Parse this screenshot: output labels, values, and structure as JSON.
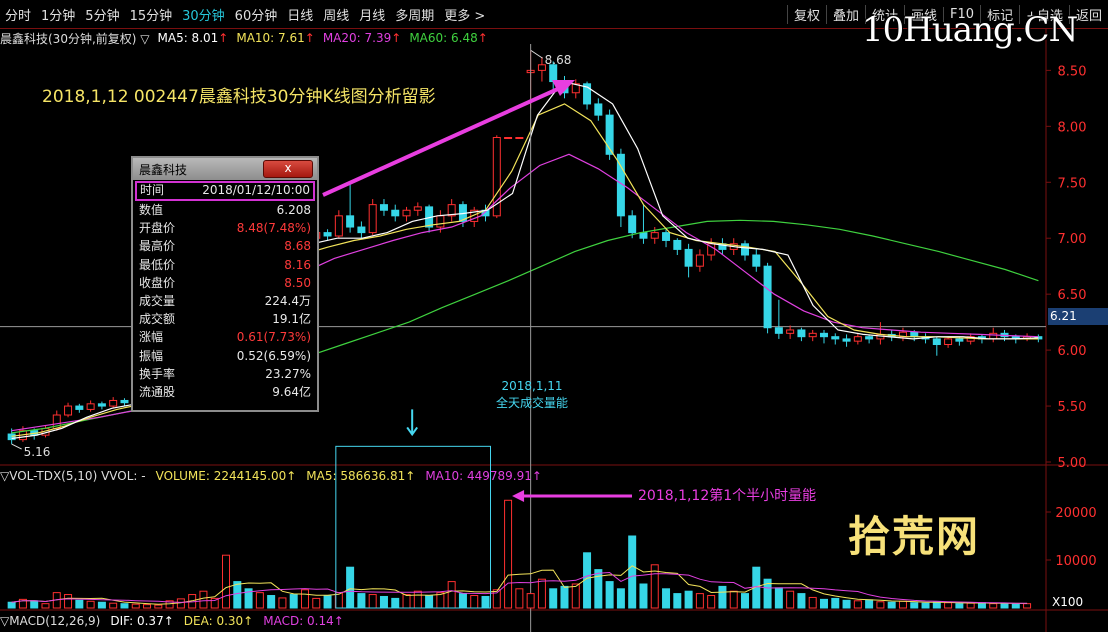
{
  "toolbar": {
    "periods": [
      "分时",
      "1分钟",
      "5分钟",
      "15分钟",
      "30分钟",
      "60分钟",
      "日线",
      "周线",
      "月线",
      "多周期",
      "更多 >"
    ],
    "active_period": "30分钟",
    "right_buttons": [
      "复权",
      "叠加",
      "统计",
      "画线",
      "F10",
      "标记",
      "+自选",
      "返回"
    ]
  },
  "brand_logo": "10Huang.CN",
  "brand_watermark": "拾荒网",
  "ma_legend": {
    "title": "晨鑫科技(30分钟,前复权) ▽",
    "ma5": "MA5: 8.01",
    "ma10": "MA10: 7.61",
    "ma20": "MA20: 7.39",
    "ma60": "MA60: 6.48",
    "arrow": "↑"
  },
  "annotation": "2018,1,12 002447晨鑫科技30分钟K线图分析留影",
  "volume_note": {
    "line1": "2018,1,11",
    "line2": "全天成交量能"
  },
  "volume_bar_label": "2018,1,12第1个半小时量能",
  "vol_legend": {
    "title": "▽VOL-TDX(5,10)  VVOL: -",
    "volume": "VOLUME: 2244145.00↑",
    "ma5": "MA5: 586636.81↑",
    "ma10": "MA10: 449789.91↑"
  },
  "macd_legend": {
    "title": "▽MACD(12,26,9)",
    "dif": "DIF: 0.37↑",
    "dea": "DEA: 0.30↑",
    "macd": "MACD: 0.14↑"
  },
  "price_axis": [
    "8.50",
    "8.00",
    "7.50",
    "7.00",
    "6.50",
    "6.00",
    "5.50",
    "5.00"
  ],
  "volume_axis": [
    "20000",
    "10000"
  ],
  "volume_unit": "X100",
  "current_price_tag": "6.21",
  "high_label": "8.68",
  "low_label": "5.16",
  "info_window": {
    "title": "晨鑫科技",
    "close_label": "x",
    "rows": [
      {
        "k": "时间",
        "v": "2018/01/12/10:00",
        "red": false,
        "hl": true
      },
      {
        "k": "数值",
        "v": "6.208",
        "red": false
      },
      {
        "k": "开盘价",
        "v": "8.48(7.48%)",
        "red": true
      },
      {
        "k": "最高价",
        "v": "8.68",
        "red": true
      },
      {
        "k": "最低价",
        "v": "8.16",
        "red": true
      },
      {
        "k": "收盘价",
        "v": "8.50",
        "red": true
      },
      {
        "k": "成交量",
        "v": "224.4万",
        "red": false
      },
      {
        "k": "成交额",
        "v": "19.1亿",
        "red": false
      },
      {
        "k": "涨幅",
        "v": "0.61(7.73%)",
        "red": true
      },
      {
        "k": "振幅",
        "v": "0.52(6.59%)",
        "red": false
      },
      {
        "k": "换手率",
        "v": "23.27%",
        "red": false
      },
      {
        "k": "流通股",
        "v": "9.64亿",
        "red": false
      }
    ]
  },
  "colors": {
    "up": "#ff3030",
    "down": "#36d6e7",
    "ma5": "#ffffff",
    "ma10": "#f2e35a",
    "ma20": "#e040e0",
    "ma60": "#3fd13f",
    "grid": "#7a0f0f"
  },
  "chart_data": {
    "type": "candlestick",
    "price_range": [
      5.0,
      8.7
    ],
    "volume_range": [
      0,
      25000
    ],
    "candles": [
      [
        5.25,
        5.2,
        5.3,
        5.16
      ],
      [
        5.2,
        5.28,
        5.32,
        5.18
      ],
      [
        5.28,
        5.24,
        5.3,
        5.2
      ],
      [
        5.24,
        5.3,
        5.33,
        5.22
      ],
      [
        5.3,
        5.42,
        5.46,
        5.28
      ],
      [
        5.42,
        5.5,
        5.53,
        5.4
      ],
      [
        5.5,
        5.47,
        5.52,
        5.44
      ],
      [
        5.47,
        5.52,
        5.55,
        5.45
      ],
      [
        5.52,
        5.5,
        5.54,
        5.47
      ],
      [
        5.5,
        5.55,
        5.58,
        5.48
      ],
      [
        5.55,
        5.53,
        5.57,
        5.5
      ],
      [
        5.53,
        5.56,
        5.6,
        5.51
      ],
      [
        5.56,
        5.6,
        5.63,
        5.54
      ],
      [
        5.6,
        5.65,
        5.68,
        5.58
      ],
      [
        5.65,
        5.7,
        5.72,
        5.62
      ],
      [
        6.5,
        6.6,
        6.72,
        6.45
      ],
      [
        6.6,
        6.72,
        6.75,
        6.58
      ],
      [
        6.72,
        6.75,
        6.78,
        6.7
      ],
      [
        6.75,
        6.75,
        6.75,
        6.75
      ],
      [
        6.9,
        7.25,
        7.3,
        6.85
      ],
      [
        7.25,
        7.1,
        7.28,
        7.05
      ],
      [
        7.1,
        6.95,
        7.12,
        6.9
      ],
      [
        6.95,
        7.0,
        7.05,
        6.88
      ],
      [
        7.0,
        6.95,
        7.03,
        6.9
      ],
      [
        6.95,
        6.98,
        7.02,
        6.92
      ],
      [
        6.98,
        6.9,
        7.0,
        6.85
      ],
      [
        6.9,
        7.0,
        7.05,
        6.86
      ],
      [
        7.0,
        7.05,
        7.1,
        6.95
      ],
      [
        7.05,
        7.02,
        7.08,
        6.98
      ],
      [
        7.02,
        7.2,
        7.25,
        7.0
      ],
      [
        7.2,
        7.1,
        7.48,
        7.05
      ],
      [
        7.1,
        7.05,
        7.15,
        7.0
      ],
      [
        7.05,
        7.3,
        7.35,
        7.03
      ],
      [
        7.3,
        7.25,
        7.35,
        7.2
      ],
      [
        7.25,
        7.2,
        7.3,
        7.15
      ],
      [
        7.2,
        7.25,
        7.28,
        7.15
      ],
      [
        7.25,
        7.28,
        7.32,
        7.2
      ],
      [
        7.28,
        7.1,
        7.3,
        7.05
      ],
      [
        7.1,
        7.2,
        7.25,
        7.05
      ],
      [
        7.2,
        7.3,
        7.35,
        7.15
      ],
      [
        7.3,
        7.15,
        7.33,
        7.1
      ],
      [
        7.15,
        7.25,
        7.28,
        7.1
      ],
      [
        7.25,
        7.2,
        7.3,
        7.15
      ],
      [
        7.2,
        7.9,
        7.92,
        7.18
      ],
      [
        7.9,
        7.9,
        7.9,
        7.9
      ],
      [
        7.9,
        7.9,
        7.9,
        7.9
      ],
      [
        8.48,
        8.5,
        8.68,
        8.16
      ],
      [
        8.5,
        8.55,
        8.62,
        8.4
      ],
      [
        8.55,
        8.4,
        8.58,
        8.3
      ],
      [
        8.4,
        8.3,
        8.45,
        8.25
      ],
      [
        8.3,
        8.38,
        8.42,
        8.25
      ],
      [
        8.38,
        8.2,
        8.4,
        8.15
      ],
      [
        8.2,
        8.1,
        8.25,
        8.05
      ],
      [
        8.1,
        7.75,
        8.15,
        7.7
      ],
      [
        7.75,
        7.2,
        7.8,
        7.1
      ],
      [
        7.2,
        7.05,
        7.25,
        7.0
      ],
      [
        7.05,
        7.0,
        7.3,
        6.95
      ],
      [
        7.0,
        7.05,
        7.1,
        6.95
      ],
      [
        7.05,
        6.98,
        7.08,
        6.92
      ],
      [
        6.98,
        6.9,
        7.0,
        6.85
      ],
      [
        6.9,
        6.75,
        6.95,
        6.65
      ],
      [
        6.75,
        6.85,
        6.9,
        6.7
      ],
      [
        6.85,
        6.95,
        7.0,
        6.8
      ],
      [
        6.95,
        6.9,
        7.0,
        6.85
      ],
      [
        6.9,
        6.95,
        7.0,
        6.85
      ],
      [
        6.95,
        6.85,
        6.98,
        6.8
      ],
      [
        6.85,
        6.75,
        6.9,
        6.7
      ],
      [
        6.75,
        6.2,
        6.78,
        6.15
      ],
      [
        6.2,
        6.15,
        6.45,
        6.1
      ],
      [
        6.15,
        6.18,
        6.22,
        6.1
      ],
      [
        6.18,
        6.12,
        6.2,
        6.08
      ],
      [
        6.12,
        6.15,
        6.18,
        6.08
      ],
      [
        6.15,
        6.12,
        6.18,
        6.06
      ],
      [
        6.12,
        6.1,
        6.15,
        6.05
      ],
      [
        6.1,
        6.08,
        6.14,
        6.03
      ],
      [
        6.08,
        6.12,
        6.15,
        6.05
      ],
      [
        6.12,
        6.1,
        6.14,
        6.06
      ],
      [
        6.1,
        6.14,
        6.25,
        6.05
      ],
      [
        6.14,
        6.12,
        6.18,
        6.08
      ],
      [
        6.12,
        6.16,
        6.2,
        6.08
      ],
      [
        6.16,
        6.12,
        6.18,
        6.08
      ],
      [
        6.12,
        6.1,
        6.15,
        6.06
      ],
      [
        6.1,
        6.05,
        6.12,
        5.95
      ],
      [
        6.05,
        6.1,
        6.12,
        6.02
      ],
      [
        6.1,
        6.08,
        6.12,
        6.04
      ],
      [
        6.08,
        6.12,
        6.15,
        6.05
      ],
      [
        6.12,
        6.1,
        6.14,
        6.06
      ],
      [
        6.1,
        6.15,
        6.2,
        6.07
      ],
      [
        6.15,
        6.12,
        6.18,
        6.08
      ],
      [
        6.12,
        6.1,
        6.14,
        6.06
      ],
      [
        6.1,
        6.12,
        6.15,
        6.08
      ],
      [
        6.12,
        6.1,
        6.14,
        6.07
      ]
    ],
    "volumes": [
      1200,
      1800,
      1500,
      900,
      3200,
      2800,
      1600,
      1400,
      1200,
      1000,
      900,
      800,
      700,
      600,
      1500,
      1900,
      2800,
      3500,
      2000,
      11000,
      5500,
      4000,
      3200,
      2600,
      2100,
      2800,
      3800,
      2000,
      2500,
      3200,
      8500,
      3000,
      2800,
      2400,
      2000,
      2800,
      3500,
      2600,
      3200,
      5500,
      3000,
      2600,
      2400,
      3800,
      22441,
      4000,
      3000,
      6000,
      4000,
      4500,
      5000,
      11500,
      8000,
      5500,
      4000,
      15000,
      5000,
      9000,
      4000,
      3000,
      3500,
      3000,
      2600,
      4500,
      3500,
      3000,
      8500,
      6000,
      4200,
      3500,
      3000,
      2200,
      1800,
      2000,
      1600,
      1500,
      1700,
      1300,
      1200,
      1400,
      1100,
      1000,
      1200,
      1100,
      900,
      1000,
      1100,
      900,
      1000,
      800,
      900
    ],
    "ma5_points": [
      5.21,
      5.24,
      5.3,
      5.4,
      5.48,
      5.52,
      5.56,
      5.62,
      6.0,
      6.5,
      6.72,
      6.85,
      6.95,
      7.0,
      7.0,
      7.05,
      7.15,
      7.2,
      7.22,
      7.25,
      7.4,
      8.1,
      8.4,
      8.35,
      8.2,
      7.8,
      7.2,
      7.0,
      6.95,
      6.92,
      6.9,
      6.85,
      6.4,
      6.18,
      6.14,
      6.12,
      6.1,
      6.12,
      6.12,
      6.1,
      6.1,
      6.11
    ],
    "ma10_points": [
      5.23,
      5.26,
      5.32,
      5.4,
      5.47,
      5.52,
      5.58,
      5.7,
      6.2,
      6.55,
      6.75,
      6.85,
      6.92,
      6.98,
      7.02,
      7.08,
      7.12,
      7.15,
      7.25,
      7.6,
      8.1,
      8.2,
      8.05,
      7.7,
      7.3,
      7.05,
      6.98,
      6.95,
      6.92,
      6.88,
      6.6,
      6.3,
      6.18,
      6.14,
      6.12,
      6.12,
      6.11,
      6.1,
      6.1,
      6.1
    ],
    "ma20_points": [
      5.28,
      5.32,
      5.36,
      5.4,
      5.45,
      5.5,
      5.6,
      5.9,
      6.3,
      6.55,
      6.7,
      6.82,
      6.9,
      6.98,
      7.05,
      7.1,
      7.2,
      7.45,
      7.65,
      7.75,
      7.62,
      7.45,
      7.25,
      7.05,
      6.9,
      6.7,
      6.5,
      6.35,
      6.25,
      6.2,
      6.18,
      6.16,
      6.15,
      6.14,
      6.13,
      6.12
    ],
    "ma60_points": [
      5.26,
      5.3,
      5.36,
      5.42,
      5.48,
      5.55,
      5.65,
      5.75,
      5.85,
      5.95,
      6.05,
      6.15,
      6.25,
      6.38,
      6.5,
      6.62,
      6.75,
      6.88,
      6.98,
      7.05,
      7.1,
      7.15,
      7.16,
      7.15,
      7.12,
      7.08,
      7.02,
      6.95,
      6.88,
      6.8,
      6.72,
      6.62
    ]
  }
}
